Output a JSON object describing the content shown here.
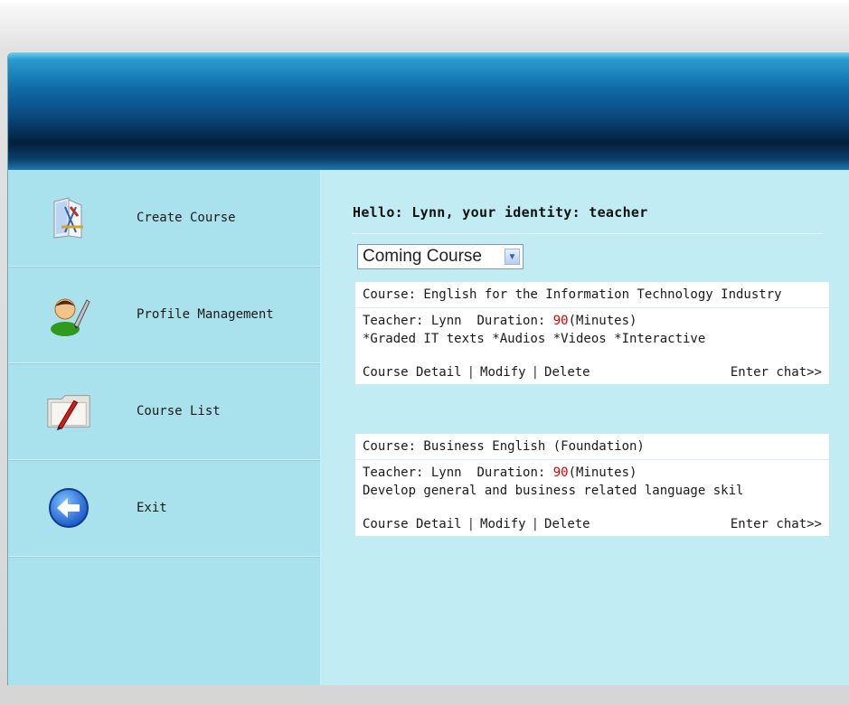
{
  "sidebar": {
    "items": [
      {
        "label": "Create Course",
        "icon": "create-course-icon"
      },
      {
        "label": "Profile Management",
        "icon": "profile-user-icon"
      },
      {
        "label": "Course List",
        "icon": "course-list-icon"
      },
      {
        "label": "Exit",
        "icon": "exit-back-arrow-icon"
      }
    ]
  },
  "main": {
    "greeting": "Hello: Lynn, your identity: teacher",
    "filter": {
      "selected": "Coming Course"
    },
    "courses": [
      {
        "title": "Course: English for the Information Technology Industry",
        "teacher": "Teacher: Lynn",
        "duration_label": "Duration:",
        "duration_value": "90",
        "duration_unit": "(Minutes)",
        "description": "*Graded IT texts *Audios *Videos *Interactive",
        "actions": {
          "detail": "Course Detail",
          "modify": "Modify",
          "delete": "Delete",
          "chat": "Enter chat>>"
        }
      },
      {
        "title": "Course: Business English (Foundation)",
        "teacher": "Teacher: Lynn",
        "duration_label": "Duration:",
        "duration_value": "90",
        "duration_unit": "(Minutes)",
        "description": "Develop general and business related language skil",
        "actions": {
          "detail": "Course Detail",
          "modify": "Modify",
          "delete": "Delete",
          "chat": "Enter chat>>"
        }
      }
    ]
  },
  "colors": {
    "banner_dark": "#03203b",
    "sidebar": "#a9e1ec",
    "main": "#c2ecf3",
    "duration": "#e00000"
  }
}
